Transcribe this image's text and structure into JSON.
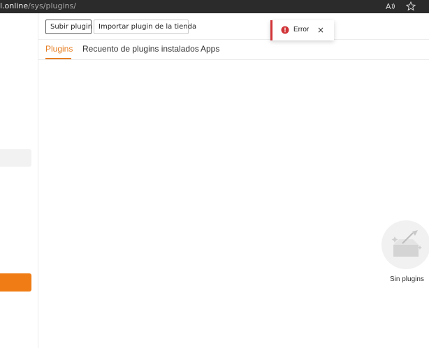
{
  "browser": {
    "url_host": "l.online",
    "url_path": "/sys/plugins/",
    "icons": [
      "read-aloud-icon",
      "favorite-star-icon"
    ]
  },
  "toolbar": {
    "upload_label": "Subir plugin",
    "import_label": "Importar plugin de la tienda"
  },
  "tabs": [
    {
      "label": "Plugins",
      "active": true
    },
    {
      "label": "Recuento de plugins instalados",
      "active": false
    },
    {
      "label": "Apps",
      "active": false
    }
  ],
  "toast": {
    "message": "Error",
    "close_symbol": "×",
    "icon": "error-circle-icon",
    "accent_color": "#d13438"
  },
  "empty_state": {
    "text": "Sin plugins",
    "icon": "empty-box-icon"
  },
  "colors": {
    "accent": "#e67e22",
    "sidebar_button": "#f07c15"
  }
}
